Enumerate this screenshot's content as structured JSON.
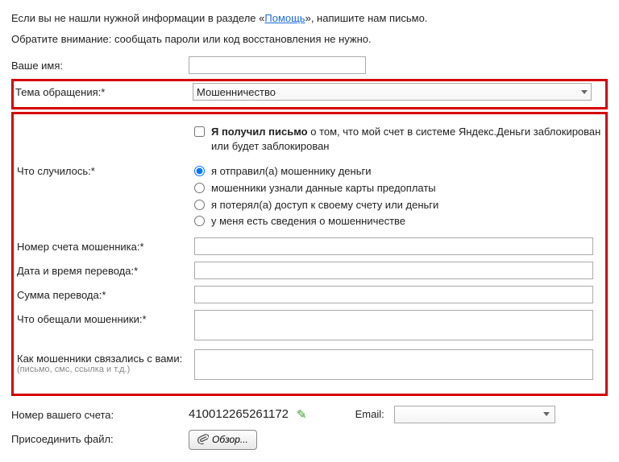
{
  "intro": {
    "line1_pre": "Если вы не нашли нужной информации в разделе «",
    "help_link": "Помощь",
    "line1_post": "», напишите нам письмо.",
    "line2": "Обратите внимание: сообщать пароли или код восстановления не нужно."
  },
  "labels": {
    "name": "Ваше имя:",
    "subject": "Тема обращения:*",
    "what_happened": "Что случилось:*",
    "scammer_account": "Номер счета мошенника:*",
    "transfer_datetime": "Дата и время перевода:*",
    "transfer_amount": "Сумма перевода:*",
    "what_promised": "Что обещали мошенники:*",
    "how_contacted": "Как мошенники связались с вами:",
    "how_contacted_sub": "(письмо, смс, ссылка и т.д.)",
    "your_account": "Номер вашего счета:",
    "email": "Email:",
    "attach": "Присоединить файл:"
  },
  "subject_value": "Мошенничество",
  "blocked_check": {
    "bold": "Я получил письмо",
    "rest": " о том, что мой счет в системе Яндекс.Деньги заблокирован или будет заблокирован"
  },
  "radios": [
    "я отправил(а) мошеннику деньги",
    "мошенники узнали данные карты предоплаты",
    "я потерял(а) доступ к своему счету или деньги",
    "у меня есть сведения о мошенничестве"
  ],
  "account_number": "410012265261172",
  "browse_label": "Обзор..."
}
